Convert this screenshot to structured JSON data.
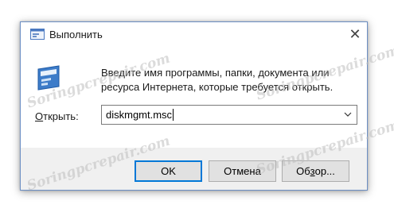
{
  "window": {
    "title": "Выполнить",
    "close_glyph": "✕"
  },
  "description": "Введите имя программы, папки, документа или ресурса Интернета, которые требуется открыть.",
  "open": {
    "label_prefix": "О",
    "label_rest": "ткрыть:",
    "value": "diskmgmt.msc"
  },
  "buttons": {
    "ok": "OK",
    "cancel": "Отмена",
    "browse_prefix": "Об",
    "browse_accel": "з",
    "browse_rest": "ор..."
  },
  "watermark": "Soringpcrepair.com",
  "colors": {
    "accent": "#0078d7",
    "footer_bg": "#f0f0f0",
    "window_border": "#6c8fc4"
  }
}
